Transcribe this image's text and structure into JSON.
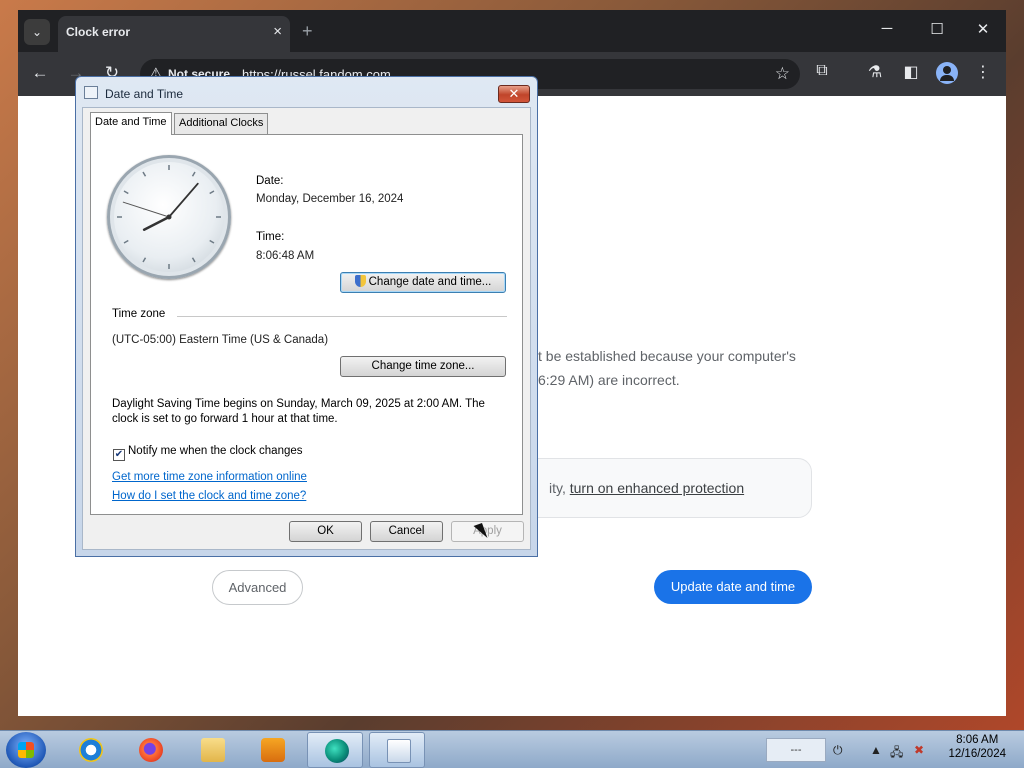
{
  "browser": {
    "tab_title": "Clock error",
    "tab_close": "×",
    "new_tab": "+",
    "security_label": "Not secure",
    "url": "https://russel.fandom.com",
    "page": {
      "message_line1": "t be established because your computer's",
      "message_line2": "6:29 AM) are incorrect.",
      "safe_prefix": "ity, ",
      "safe_link": "turn on enhanced protection",
      "advanced_label": "Advanced",
      "update_label": "Update date and time"
    },
    "colors": {
      "frame": "#202124",
      "toolbar": "#35363a",
      "primary_button": "#1a73e8"
    }
  },
  "dialog": {
    "title": "Date and Time",
    "close_glyph": "✕",
    "tabs": [
      {
        "label": "Date and Time",
        "active": true
      },
      {
        "label": "Additional Clocks",
        "active": false
      }
    ],
    "date_label": "Date:",
    "date_value": "Monday, December 16, 2024",
    "time_label": "Time:",
    "time_value": "8:06:48 AM",
    "change_datetime_label": "Change date and time...",
    "timezone_heading": "Time zone",
    "timezone_value": "(UTC-05:00) Eastern Time (US & Canada)",
    "change_timezone_label": "Change time zone...",
    "dst_line1": "Daylight Saving Time begins on Sunday, March 09, 2025 at 2:00 AM. The",
    "dst_line2": "clock is set to go forward 1 hour at that time.",
    "notify_label": "Notify me when the clock changes",
    "notify_checked": true,
    "link_more_info": "Get more time zone information online",
    "link_howto": "How do I set the clock and time zone?",
    "ok_label": "OK",
    "cancel_label": "Cancel",
    "apply_label": "Apply",
    "clock": {
      "hour": 8,
      "minute": 6,
      "second": 48
    }
  },
  "taskbar": {
    "apps": [
      "internet-explorer-icon",
      "firefox-icon",
      "file-explorer-icon",
      "media-player-icon",
      "active-app-icon",
      "calendar-clock-icon"
    ],
    "clock_time": "8:06 AM",
    "clock_date": "12/16/2024",
    "tray_box": "---"
  }
}
